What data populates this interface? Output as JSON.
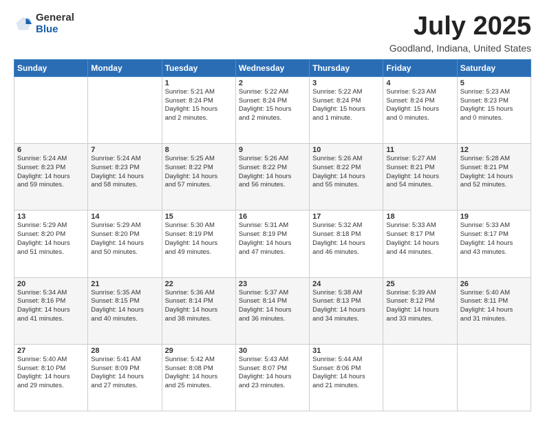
{
  "logo": {
    "general": "General",
    "blue": "Blue"
  },
  "header": {
    "title": "July 2025",
    "subtitle": "Goodland, Indiana, United States"
  },
  "weekdays": [
    "Sunday",
    "Monday",
    "Tuesday",
    "Wednesday",
    "Thursday",
    "Friday",
    "Saturday"
  ],
  "weeks": [
    [
      {
        "day": "",
        "info": ""
      },
      {
        "day": "",
        "info": ""
      },
      {
        "day": "1",
        "info": "Sunrise: 5:21 AM\nSunset: 8:24 PM\nDaylight: 15 hours\nand 2 minutes."
      },
      {
        "day": "2",
        "info": "Sunrise: 5:22 AM\nSunset: 8:24 PM\nDaylight: 15 hours\nand 2 minutes."
      },
      {
        "day": "3",
        "info": "Sunrise: 5:22 AM\nSunset: 8:24 PM\nDaylight: 15 hours\nand 1 minute."
      },
      {
        "day": "4",
        "info": "Sunrise: 5:23 AM\nSunset: 8:24 PM\nDaylight: 15 hours\nand 0 minutes."
      },
      {
        "day": "5",
        "info": "Sunrise: 5:23 AM\nSunset: 8:23 PM\nDaylight: 15 hours\nand 0 minutes."
      }
    ],
    [
      {
        "day": "6",
        "info": "Sunrise: 5:24 AM\nSunset: 8:23 PM\nDaylight: 14 hours\nand 59 minutes."
      },
      {
        "day": "7",
        "info": "Sunrise: 5:24 AM\nSunset: 8:23 PM\nDaylight: 14 hours\nand 58 minutes."
      },
      {
        "day": "8",
        "info": "Sunrise: 5:25 AM\nSunset: 8:22 PM\nDaylight: 14 hours\nand 57 minutes."
      },
      {
        "day": "9",
        "info": "Sunrise: 5:26 AM\nSunset: 8:22 PM\nDaylight: 14 hours\nand 56 minutes."
      },
      {
        "day": "10",
        "info": "Sunrise: 5:26 AM\nSunset: 8:22 PM\nDaylight: 14 hours\nand 55 minutes."
      },
      {
        "day": "11",
        "info": "Sunrise: 5:27 AM\nSunset: 8:21 PM\nDaylight: 14 hours\nand 54 minutes."
      },
      {
        "day": "12",
        "info": "Sunrise: 5:28 AM\nSunset: 8:21 PM\nDaylight: 14 hours\nand 52 minutes."
      }
    ],
    [
      {
        "day": "13",
        "info": "Sunrise: 5:29 AM\nSunset: 8:20 PM\nDaylight: 14 hours\nand 51 minutes."
      },
      {
        "day": "14",
        "info": "Sunrise: 5:29 AM\nSunset: 8:20 PM\nDaylight: 14 hours\nand 50 minutes."
      },
      {
        "day": "15",
        "info": "Sunrise: 5:30 AM\nSunset: 8:19 PM\nDaylight: 14 hours\nand 49 minutes."
      },
      {
        "day": "16",
        "info": "Sunrise: 5:31 AM\nSunset: 8:19 PM\nDaylight: 14 hours\nand 47 minutes."
      },
      {
        "day": "17",
        "info": "Sunrise: 5:32 AM\nSunset: 8:18 PM\nDaylight: 14 hours\nand 46 minutes."
      },
      {
        "day": "18",
        "info": "Sunrise: 5:33 AM\nSunset: 8:17 PM\nDaylight: 14 hours\nand 44 minutes."
      },
      {
        "day": "19",
        "info": "Sunrise: 5:33 AM\nSunset: 8:17 PM\nDaylight: 14 hours\nand 43 minutes."
      }
    ],
    [
      {
        "day": "20",
        "info": "Sunrise: 5:34 AM\nSunset: 8:16 PM\nDaylight: 14 hours\nand 41 minutes."
      },
      {
        "day": "21",
        "info": "Sunrise: 5:35 AM\nSunset: 8:15 PM\nDaylight: 14 hours\nand 40 minutes."
      },
      {
        "day": "22",
        "info": "Sunrise: 5:36 AM\nSunset: 8:14 PM\nDaylight: 14 hours\nand 38 minutes."
      },
      {
        "day": "23",
        "info": "Sunrise: 5:37 AM\nSunset: 8:14 PM\nDaylight: 14 hours\nand 36 minutes."
      },
      {
        "day": "24",
        "info": "Sunrise: 5:38 AM\nSunset: 8:13 PM\nDaylight: 14 hours\nand 34 minutes."
      },
      {
        "day": "25",
        "info": "Sunrise: 5:39 AM\nSunset: 8:12 PM\nDaylight: 14 hours\nand 33 minutes."
      },
      {
        "day": "26",
        "info": "Sunrise: 5:40 AM\nSunset: 8:11 PM\nDaylight: 14 hours\nand 31 minutes."
      }
    ],
    [
      {
        "day": "27",
        "info": "Sunrise: 5:40 AM\nSunset: 8:10 PM\nDaylight: 14 hours\nand 29 minutes."
      },
      {
        "day": "28",
        "info": "Sunrise: 5:41 AM\nSunset: 8:09 PM\nDaylight: 14 hours\nand 27 minutes."
      },
      {
        "day": "29",
        "info": "Sunrise: 5:42 AM\nSunset: 8:08 PM\nDaylight: 14 hours\nand 25 minutes."
      },
      {
        "day": "30",
        "info": "Sunrise: 5:43 AM\nSunset: 8:07 PM\nDaylight: 14 hours\nand 23 minutes."
      },
      {
        "day": "31",
        "info": "Sunrise: 5:44 AM\nSunset: 8:06 PM\nDaylight: 14 hours\nand 21 minutes."
      },
      {
        "day": "",
        "info": ""
      },
      {
        "day": "",
        "info": ""
      }
    ]
  ]
}
